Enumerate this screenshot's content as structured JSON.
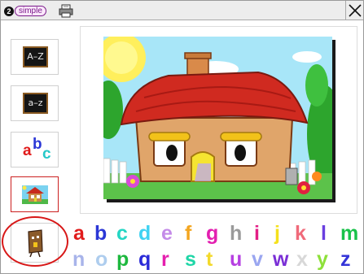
{
  "titlebar": {
    "logo_number": "2",
    "logo_word": "simple",
    "close_label": "Close"
  },
  "sidebar": {
    "items": [
      {
        "label": "A–Z",
        "name": "uppercase"
      },
      {
        "label": "a–z",
        "name": "lowercase"
      },
      {
        "label_a": "a",
        "label_b": "b",
        "label_c": "c",
        "name": "abc"
      },
      {
        "name": "pictures",
        "selected": true
      }
    ]
  },
  "letters": {
    "row1": [
      {
        "char": "a",
        "color": "#e11b1b"
      },
      {
        "char": "b",
        "color": "#2b37d6"
      },
      {
        "char": "c",
        "color": "#25d6c4"
      },
      {
        "char": "d",
        "color": "#3fd2f2"
      },
      {
        "char": "e",
        "color": "#c48be8"
      },
      {
        "char": "f",
        "color": "#f3a51f"
      },
      {
        "char": "g",
        "color": "#e31fb0"
      },
      {
        "char": "h",
        "color": "#9a9a9a"
      },
      {
        "char": "i",
        "color": "#e31f86"
      },
      {
        "char": "j",
        "color": "#f5e11c"
      },
      {
        "char": "k",
        "color": "#f06a7a"
      },
      {
        "char": "l",
        "color": "#6a3fe0"
      },
      {
        "char": "m",
        "color": "#19c24a"
      }
    ],
    "row2": [
      {
        "char": "n",
        "color": "#a8b4ea"
      },
      {
        "char": "o",
        "color": "#aecdee"
      },
      {
        "char": "p",
        "color": "#1db83e"
      },
      {
        "char": "q",
        "color": "#2b2bd8"
      },
      {
        "char": "r",
        "color": "#e51fae"
      },
      {
        "char": "s",
        "color": "#1fd6a7"
      },
      {
        "char": "t",
        "color": "#f3d92a"
      },
      {
        "char": "u",
        "color": "#b63fe2"
      },
      {
        "char": "v",
        "color": "#9aa6f0"
      },
      {
        "char": "w",
        "color": "#7a2fd6"
      },
      {
        "char": "x",
        "color": "#d8d8d8"
      },
      {
        "char": "y",
        "color": "#8de039"
      },
      {
        "char": "z",
        "color": "#3535d8"
      }
    ]
  },
  "colors": {
    "accent_red": "#d81818",
    "border_gray": "#a8a8a8"
  },
  "icons": {
    "printer": "printer-icon",
    "close": "close-icon",
    "house": "house-picture",
    "character": "house-character-icon"
  }
}
